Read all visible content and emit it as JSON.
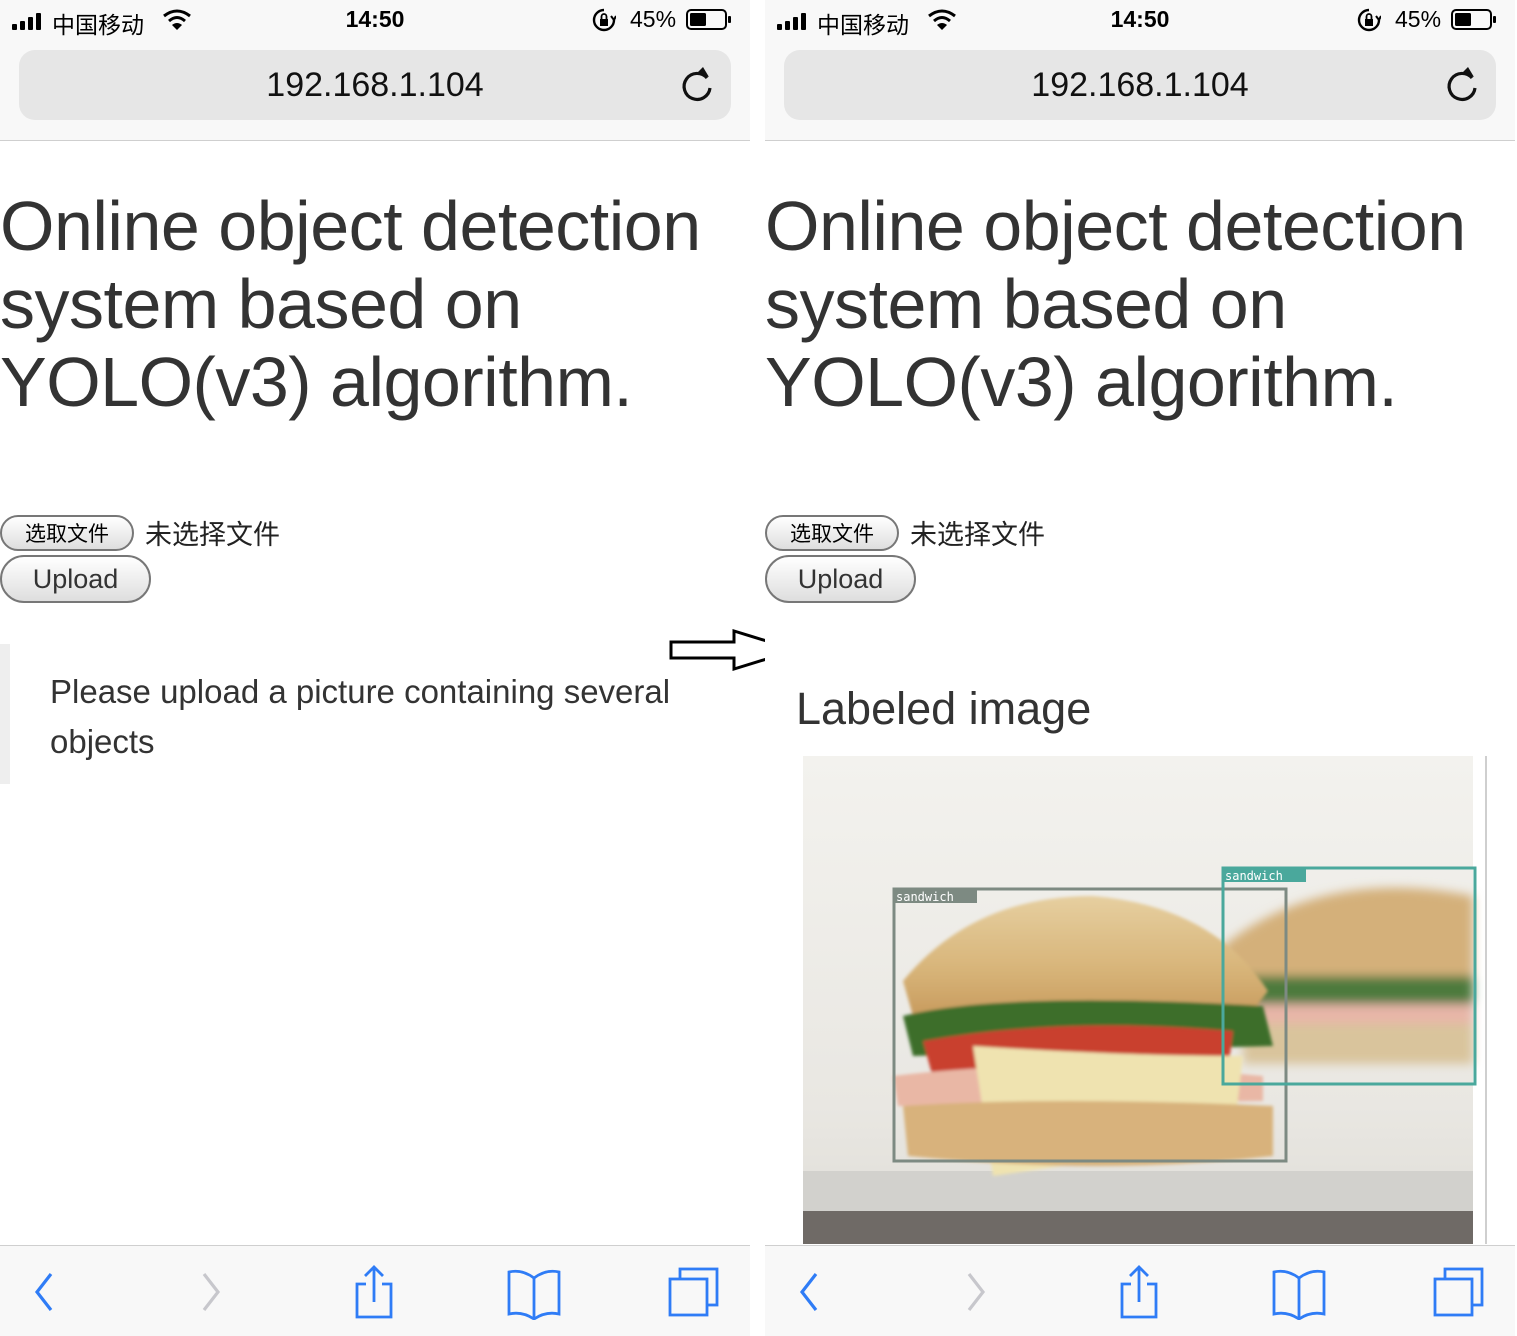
{
  "screens": {
    "left": {
      "status_bar": {
        "carrier": "中国移动",
        "time": "14:50",
        "battery_percent": "45%"
      },
      "address_bar": {
        "url": "192.168.1.104"
      },
      "page": {
        "title": "Online object detection system based on YOLO(v3) algorithm.",
        "choose_file_label": "选取文件",
        "no_file_text": "未选择文件",
        "upload_label": "Upload",
        "notice": "Please upload a picture containing several objects"
      }
    },
    "right": {
      "status_bar": {
        "carrier": "中国移动",
        "time": "14:50",
        "battery_percent": "45%"
      },
      "address_bar": {
        "url": "192.168.1.104"
      },
      "page": {
        "title": "Online object detection system based on YOLO(v3) algorithm.",
        "choose_file_label": "选取文件",
        "no_file_text": "未选择文件",
        "upload_label": "Upload",
        "result_heading": "Labeled image",
        "detections": [
          {
            "label": "sandwich",
            "color": "#7d8a82"
          },
          {
            "label": "sandwich",
            "color": "#4aa89c"
          }
        ]
      }
    }
  },
  "icons": {
    "status": [
      "signal-icon",
      "wifi-icon",
      "orientation-lock-icon",
      "battery-icon"
    ],
    "address": [
      "reload-icon"
    ],
    "toolbar": [
      "back-icon",
      "forward-icon",
      "share-icon",
      "bookmarks-icon",
      "tabs-icon"
    ]
  },
  "colors": {
    "toolbar_blue": "#2f7cf6",
    "toolbar_disabled": "#c7c7cc",
    "text": "#333333"
  }
}
